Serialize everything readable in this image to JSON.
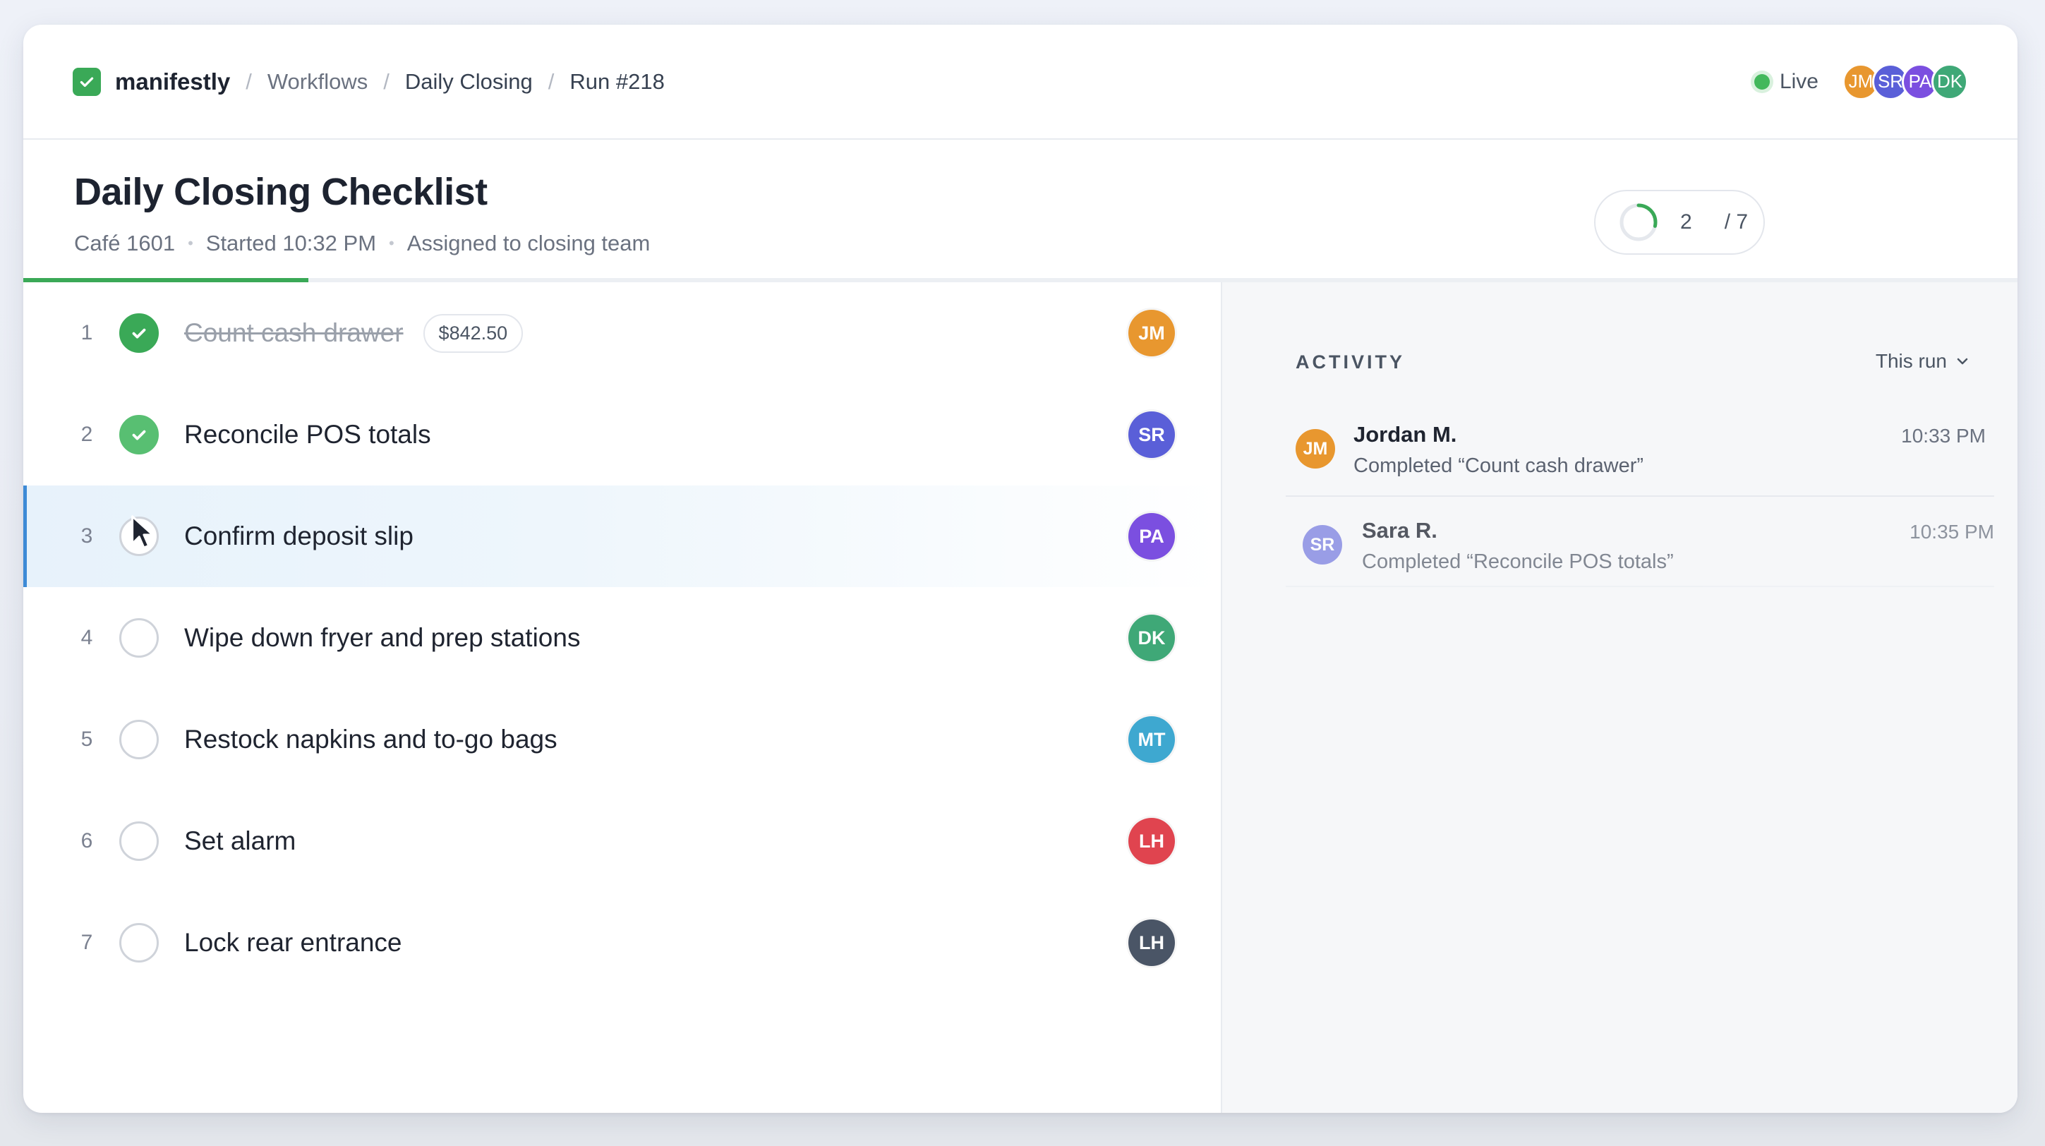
{
  "brand": "manifestly",
  "breadcrumb": [
    "Workflows",
    "Daily Closing",
    "Run #218"
  ],
  "live_label": "Live",
  "presence": [
    {
      "initials": "JM",
      "color": "#e8972f"
    },
    {
      "initials": "SR",
      "color": "#5a5fd8"
    },
    {
      "initials": "PA",
      "color": "#7b4fe0"
    },
    {
      "initials": "DK",
      "color": "#3fa877"
    }
  ],
  "page": {
    "title": "Daily Closing Checklist",
    "location": "Café 1601",
    "started": "Started 10:32 PM",
    "assigned": "Assigned to closing team"
  },
  "progress": {
    "done": "2",
    "total": "/ 7",
    "fraction": 0.2857
  },
  "colors": {
    "accent": "#3aa957",
    "active": "#3d8ad6"
  },
  "tasks": [
    {
      "num": "1",
      "label": "Count cash drawer",
      "amount": "$842.50",
      "done": true,
      "assignee": "JM",
      "color": "#e8972f"
    },
    {
      "num": "2",
      "label": "Reconcile POS totals",
      "done": true,
      "assignee": "SR",
      "color": "#5a5fd8"
    },
    {
      "num": "3",
      "label": "Confirm deposit slip",
      "done": false,
      "active": true,
      "assignee": "PA",
      "color": "#7b4fe0"
    },
    {
      "num": "4",
      "label": "Wipe down fryer and prep stations",
      "done": false,
      "assignee": "DK",
      "color": "#3fa877"
    },
    {
      "num": "5",
      "label": "Restock napkins and to-go bags",
      "done": false,
      "assignee": "MT",
      "color": "#3ea8d0"
    },
    {
      "num": "6",
      "label": "Set alarm",
      "done": false,
      "assignee": "LH",
      "color": "#e0444f"
    },
    {
      "num": "7",
      "label": "Lock rear entrance",
      "done": false,
      "assignee": "LH",
      "color": "#4a5566"
    }
  ],
  "activity": {
    "heading": "ACTIVITY",
    "filter": "This run",
    "items": [
      {
        "initials": "JM",
        "color": "#e8972f",
        "name": "Jordan M.",
        "desc": "Completed “Count cash drawer”",
        "time": "10:33 PM"
      },
      {
        "initials": "SR",
        "color": "#7a7fe0",
        "name": "Sara R.",
        "desc": "Completed “Reconcile POS totals”",
        "time": "10:35 PM"
      }
    ]
  }
}
